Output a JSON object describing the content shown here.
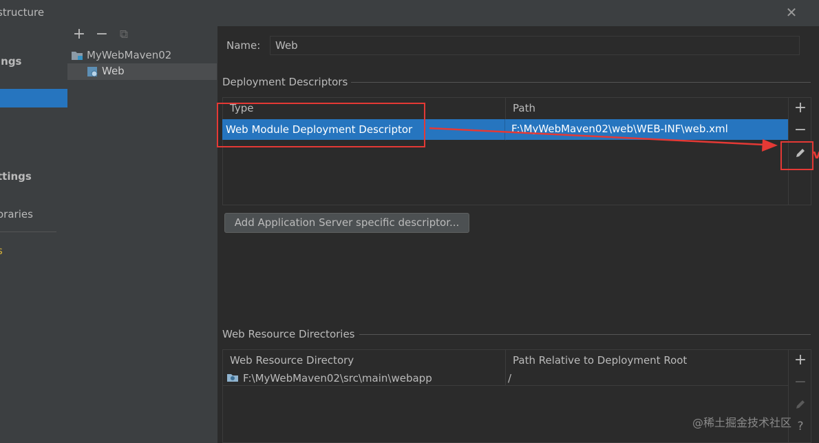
{
  "window": {
    "title": "structure",
    "close_glyph": "✕"
  },
  "left_panel": {
    "items": [
      {
        "label": "ings"
      },
      {
        "label": "ttings"
      },
      {
        "label": "oraries"
      },
      {
        "label": "s"
      }
    ]
  },
  "tree": {
    "toolbar": {
      "add": "+",
      "remove": "−",
      "copy": "⧉"
    },
    "nodes": [
      {
        "label": "MyWebMaven02",
        "icon": "module-folder-icon"
      },
      {
        "label": "Web",
        "icon": "web-facet-icon",
        "selected": true
      }
    ]
  },
  "facet": {
    "name_label": "Name:",
    "name_value": "Web",
    "deployment": {
      "title": "Deployment Descriptors",
      "columns": [
        "Type",
        "Path"
      ],
      "rows": [
        {
          "type": "Web Module Deployment Descriptor",
          "path": "F:\\MyWebMaven02\\web\\WEB-INF\\web.xml",
          "selected": true
        }
      ],
      "buttons": {
        "add": "+",
        "remove": "−",
        "edit": "edit-pencil-icon"
      },
      "server_button": "Add Application Server specific descriptor..."
    },
    "resources": {
      "title": "Web Resource Directories",
      "columns": [
        "Web Resource Directory",
        "Path Relative to Deployment Root"
      ],
      "rows": [
        {
          "directory": "F:\\MyWebMaven02\\src\\main\\webapp",
          "relative": "/"
        }
      ],
      "buttons": {
        "add": "+",
        "remove": "−",
        "edit": "edit-pencil-icon",
        "help": "?"
      }
    }
  },
  "annotation": {
    "arrow_color": "#e53935",
    "cut_text": "v"
  },
  "watermark": "@稀土掘金技术社区",
  "colors": {
    "selection": "#2675bf",
    "panel": "#3c3f41",
    "background": "#2b2b2b",
    "annotation_red": "#e53935"
  }
}
